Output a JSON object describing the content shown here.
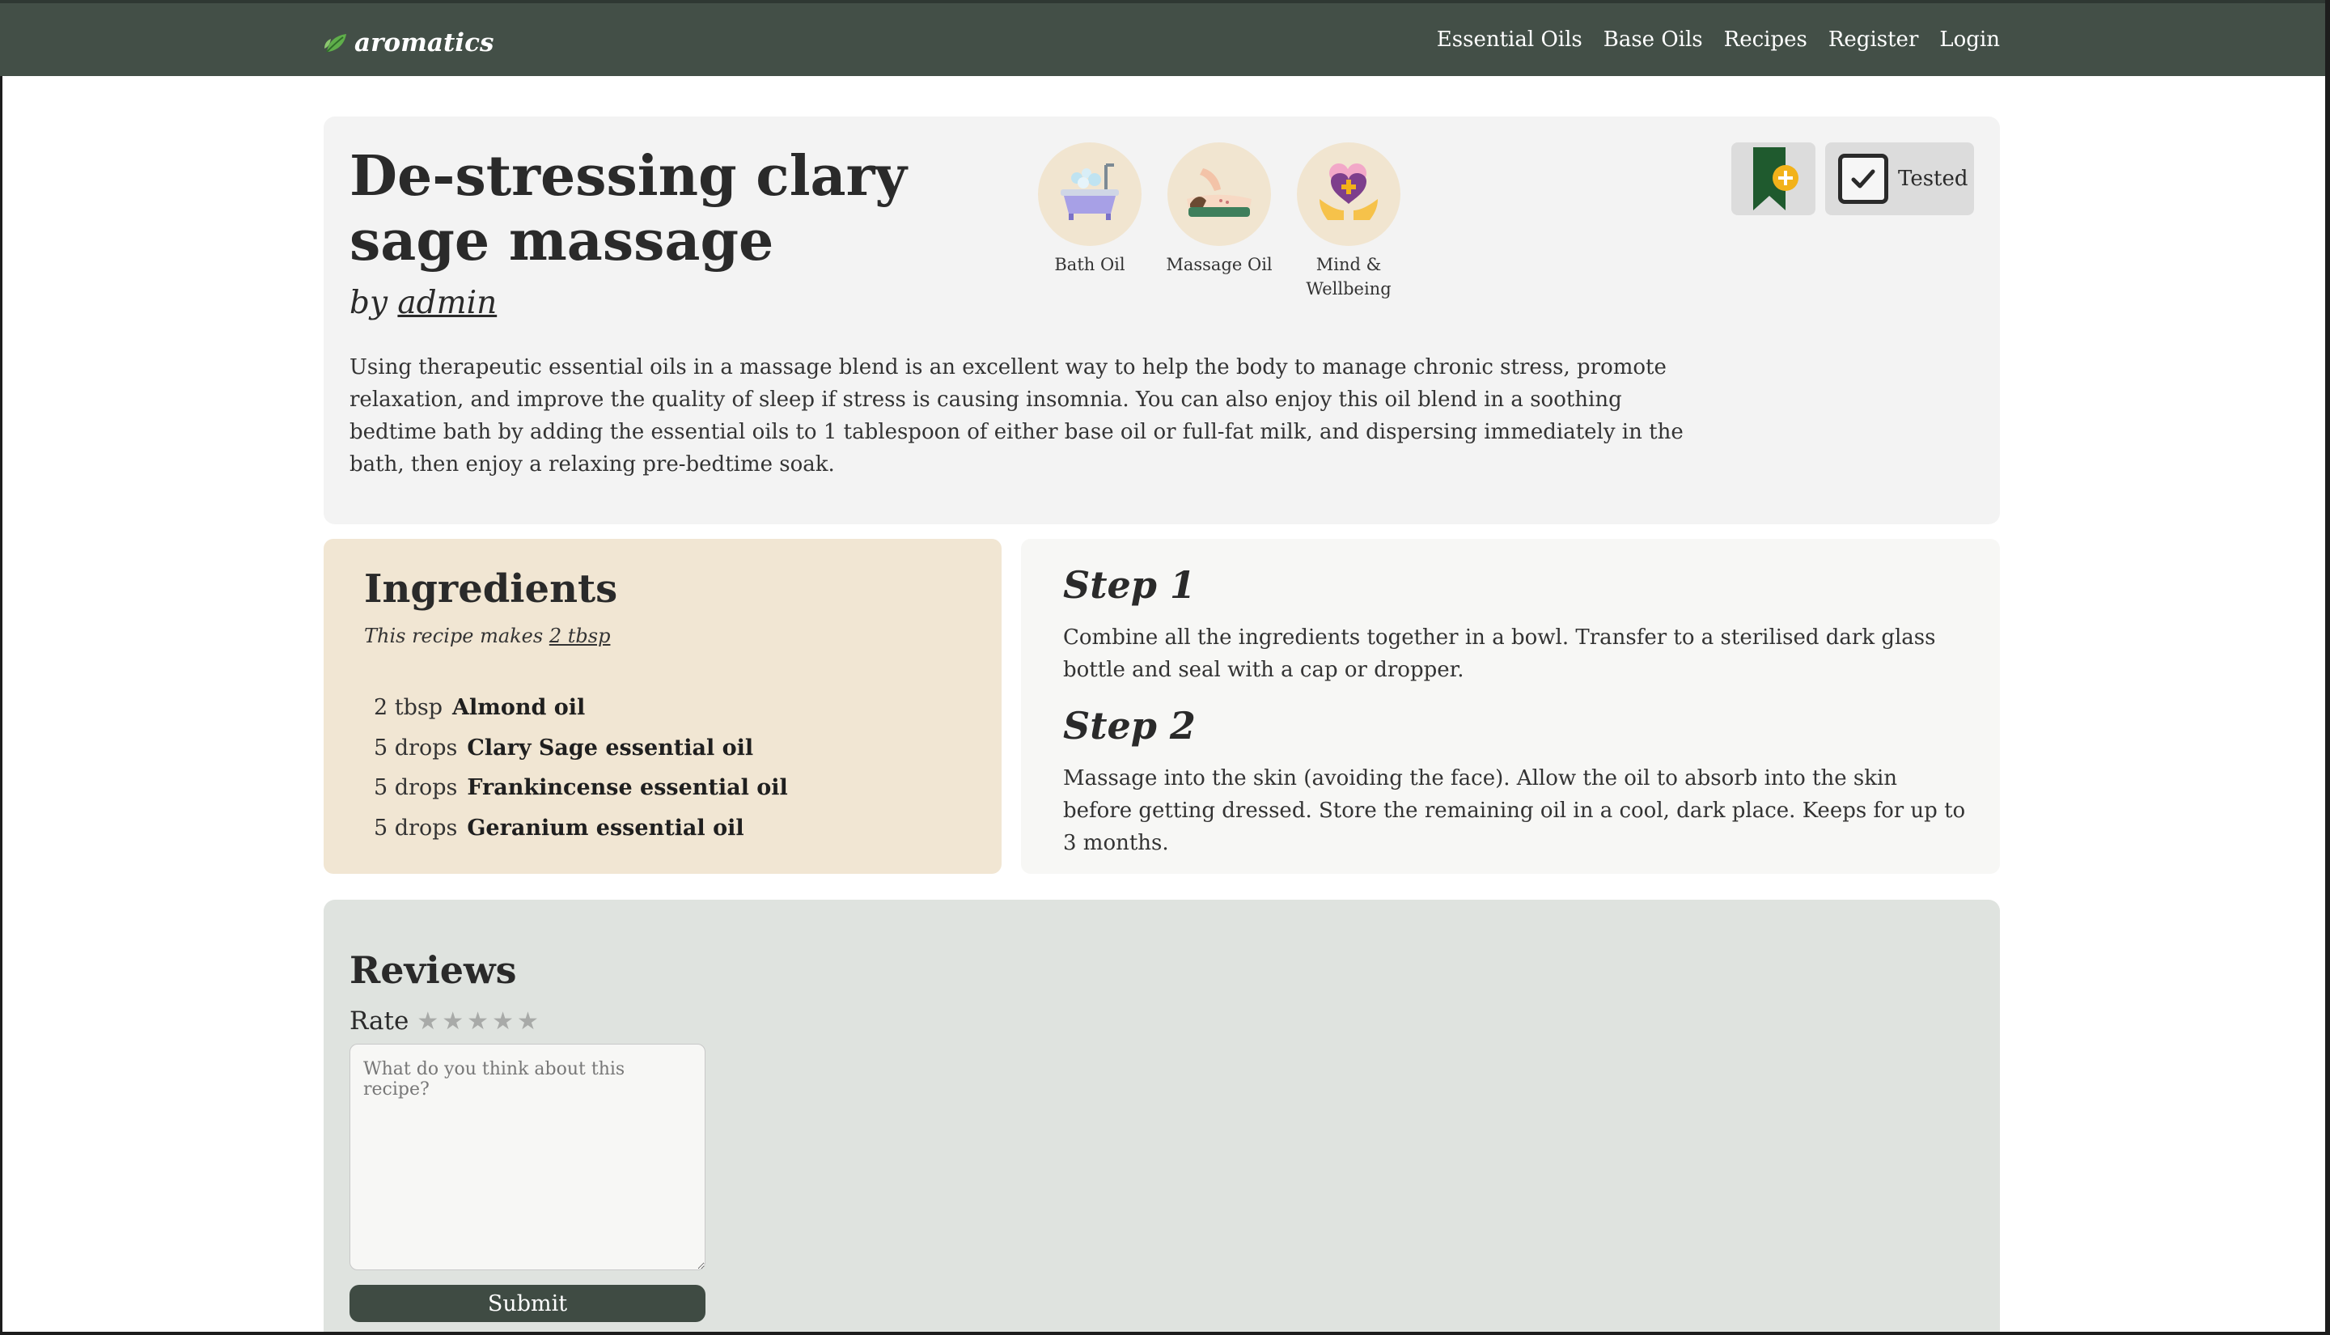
{
  "nav": {
    "logo": "aromatics",
    "links": [
      "Essential Oils",
      "Base Oils",
      "Recipes",
      "Register",
      "Login"
    ]
  },
  "recipe": {
    "title": "De-stressing clary sage massage",
    "by_prefix": "by",
    "author": "admin",
    "description": "Using therapeutic essential oils in a massage blend is an excellent way to help the body to manage chronic stress, promote relaxation, and improve the quality of sleep if stress is causing insomnia. You can also enjoy this oil blend in a soothing bedtime bath by adding the essential oils to 1 tablespoon of either base oil or full-fat milk, and dispersing immediately in the bath, then enjoy a relaxing pre-bedtime soak.",
    "categories": [
      {
        "label": "Bath Oil",
        "icon": "bathtub-icon"
      },
      {
        "label": "Massage Oil",
        "icon": "massage-icon"
      },
      {
        "label": "Mind & Wellbeing",
        "icon": "heart-hands-icon"
      }
    ],
    "tested_label": "Tested"
  },
  "ingredients": {
    "title": "Ingredients",
    "makes_prefix": "This recipe makes",
    "makes_value": "2 tbsp",
    "items": [
      {
        "qty": "2 tbsp",
        "name": "Almond oil"
      },
      {
        "qty": "5 drops",
        "name": "Clary Sage essential oil"
      },
      {
        "qty": "5 drops",
        "name": "Frankincense essential oil"
      },
      {
        "qty": "5 drops",
        "name": "Geranium essential oil"
      }
    ]
  },
  "steps": [
    {
      "title": "Step 1",
      "text": "Combine all the ingredients together in a bowl. Transfer to a sterilised dark glass bottle and seal with a cap or dropper."
    },
    {
      "title": "Step 2",
      "text": "Massage into the skin (avoiding the face). Allow the oil to absorb into the skin before getting dressed. Store the remaining oil in a cool, dark place. Keeps for up to 3 months."
    }
  ],
  "reviews": {
    "title": "Reviews",
    "rate_label": "Rate",
    "stars": [
      "★",
      "★",
      "★",
      "★",
      "★"
    ],
    "placeholder": "What do you think about this recipe?",
    "submit_label": "Submit"
  },
  "colors": {
    "nav_bg": "#434f47",
    "header_bg": "#f3f3f3",
    "ingredients_bg": "#f1e6d3",
    "steps_bg": "#f7f7f5",
    "reviews_bg": "#dfe3df",
    "submit_bg": "#3f4b43",
    "bookmark_green": "#1f5a2e",
    "bookmark_plus": "#f2b21a"
  }
}
